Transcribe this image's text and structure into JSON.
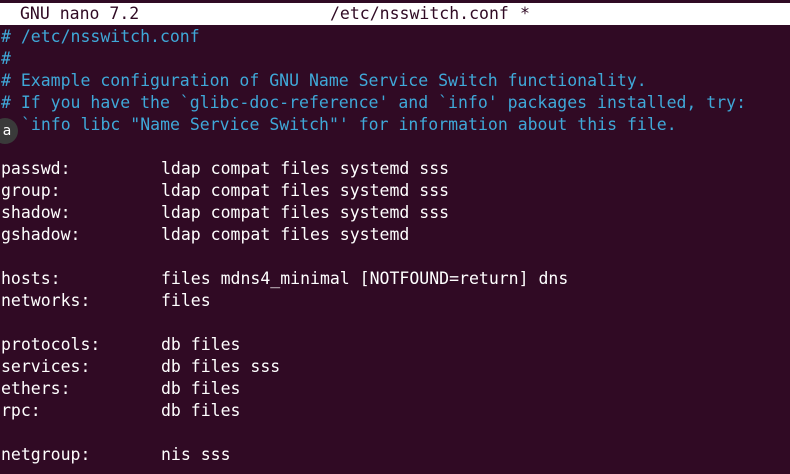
{
  "titlebar": {
    "app": "GNU nano 7.2",
    "file": "/etc/nsswitch.conf",
    "modified": "*"
  },
  "badge": {
    "label": "a"
  },
  "comments": [
    "# /etc/nsswitch.conf",
    "#",
    "# Example configuration of GNU Name Service Switch functionality.",
    "# If you have the `glibc-doc-reference' and `info' packages installed, try:",
    "`info libc \"Name Service Switch\"' for information about this file."
  ],
  "entries": [
    {
      "key": "passwd:",
      "value": "ldap compat files systemd sss"
    },
    {
      "key": "group:",
      "value": "ldap compat files systemd sss"
    },
    {
      "key": "shadow:",
      "value": "ldap compat files systemd sss"
    },
    {
      "key": "gshadow:",
      "value": "ldap compat files systemd"
    },
    {
      "key": "hosts:",
      "value": "files mdns4_minimal [NOTFOUND=return] dns"
    },
    {
      "key": "networks:",
      "value": "files"
    },
    {
      "key": "protocols:",
      "value": "db files"
    },
    {
      "key": "services:",
      "value": "db files sss"
    },
    {
      "key": "ethers:",
      "value": "db files"
    },
    {
      "key": "rpc:",
      "value": "db files"
    },
    {
      "key": "netgroup:",
      "value": "nis sss"
    }
  ],
  "colors": {
    "background": "#300a24",
    "comment": "#3fa8d8",
    "text": "#ffffff",
    "titlebar": "#ffffff"
  }
}
